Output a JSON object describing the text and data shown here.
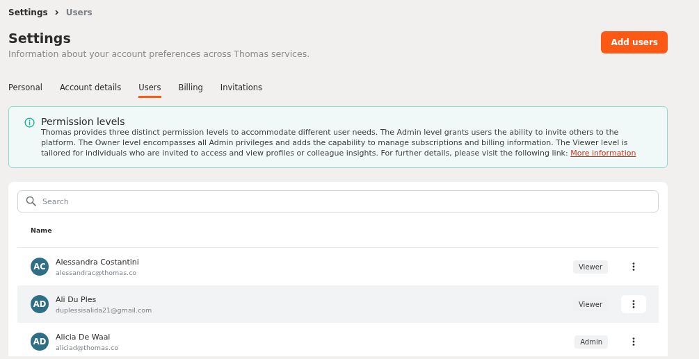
{
  "breadcrumb": [
    {
      "label": "Settings",
      "current": false
    },
    {
      "label": "Users",
      "current": true
    }
  ],
  "header": {
    "title": "Settings",
    "subtitle": "Information about your account preferences across Thomas services.",
    "action": "Add users"
  },
  "tabs": [
    {
      "label": "Personal",
      "selected": false
    },
    {
      "label": "Account details",
      "selected": false
    },
    {
      "label": "Users",
      "selected": true
    },
    {
      "label": "Billing",
      "selected": false
    },
    {
      "label": "Invitations",
      "selected": false
    }
  ],
  "notice": {
    "title": "Permission levels",
    "text": "Thomas provides three distinct permission levels to accommodate different user needs. The Admin level grants users the ability to invite others to the platform. The Owner level encompasses all Admin privileges and adds the capability to manage subscriptions and billing information. The Viewer level is tailored for individuals who are invited to access and view profiles or colleague insights. For further details, please visit the following link:",
    "link": "More information"
  },
  "search": {
    "placeholder": "Search"
  },
  "table": {
    "columns": [
      "Name"
    ],
    "rows": [
      {
        "initials": "AC",
        "name": "Alessandra Costantini",
        "email": "alessandrac@thomas.co",
        "role": "Viewer",
        "highlighted": false
      },
      {
        "initials": "AD",
        "name": "Ali Du Ples",
        "email": "duplessisalida21@gmail.com",
        "role": "Viewer",
        "highlighted": true
      },
      {
        "initials": "AD",
        "name": "Alicia De Waal",
        "email": "aliciad@thomas.co",
        "role": "Admin",
        "highlighted": false
      }
    ]
  }
}
